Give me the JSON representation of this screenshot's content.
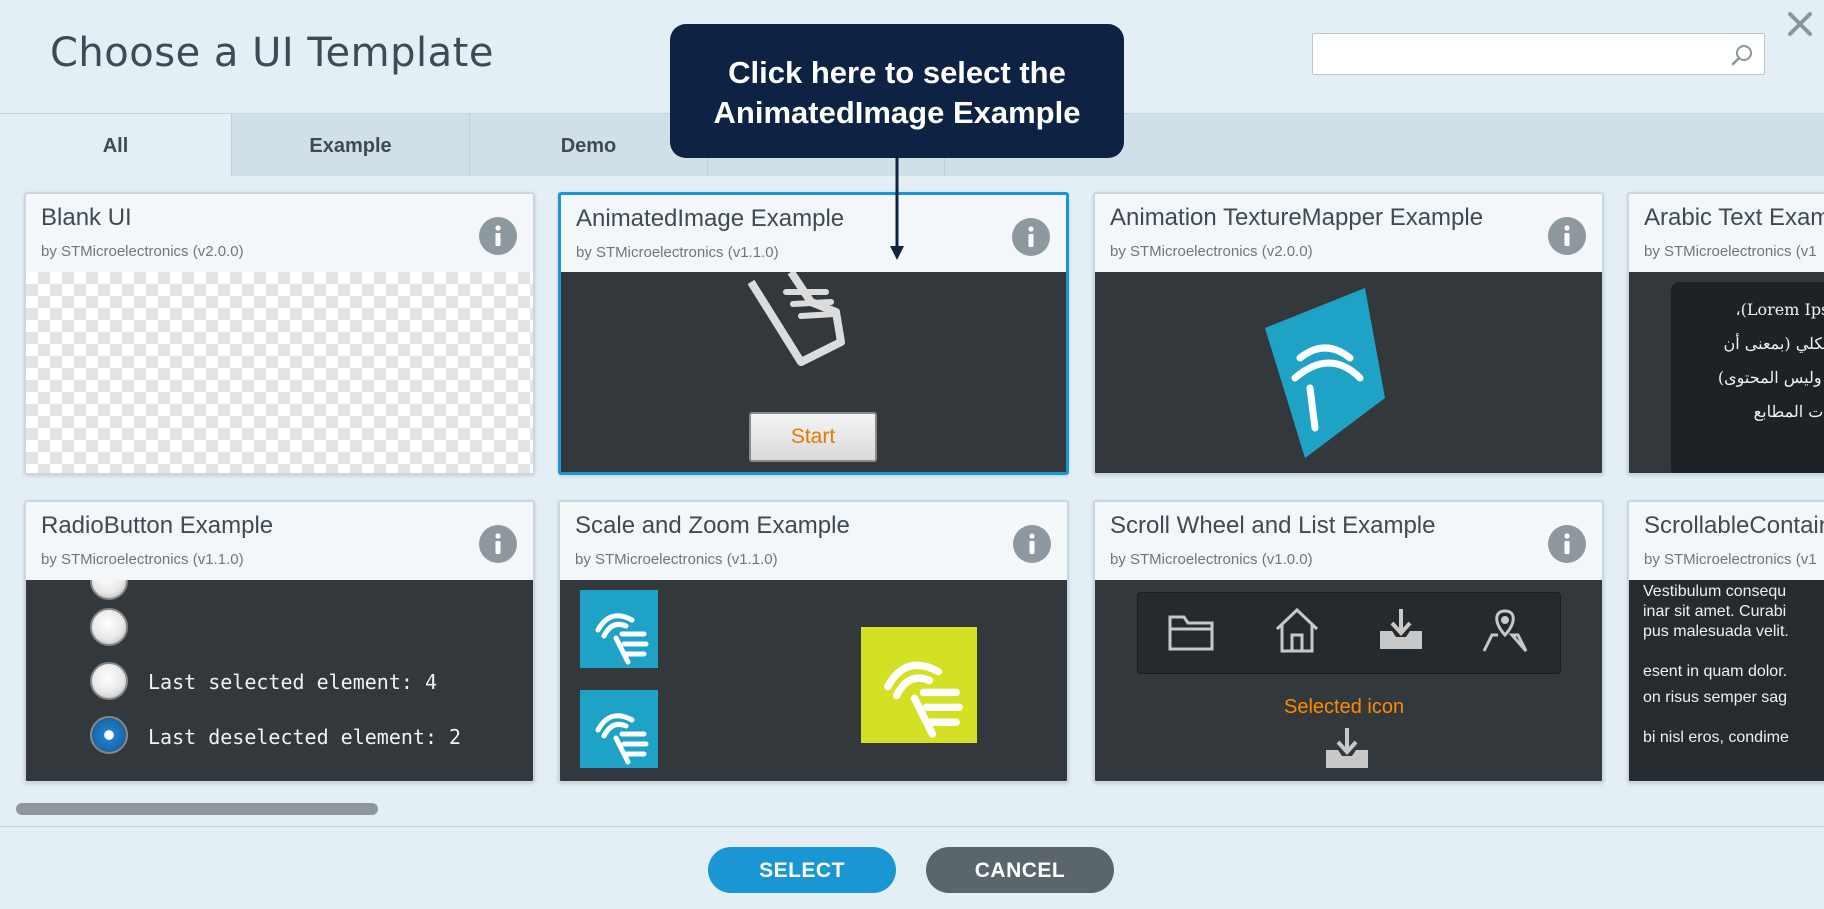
{
  "dialog": {
    "title": "Choose a UI Template",
    "search": {
      "value": "",
      "placeholder": ""
    }
  },
  "tabs": [
    {
      "label": "All",
      "active": true
    },
    {
      "label": "Example",
      "active": false
    },
    {
      "label": "Demo",
      "active": false
    },
    {
      "label": "",
      "active": false
    }
  ],
  "templates": [
    {
      "title": "Blank UI",
      "author": "by STMicroelectronics (v2.0.0)",
      "selected": false
    },
    {
      "title": "AnimatedImage Example",
      "author": "by STMicroelectronics (v1.1.0)",
      "selected": true,
      "button_label": "Start"
    },
    {
      "title": "Animation TextureMapper Example",
      "author": "by STMicroelectronics (v2.0.0)",
      "selected": false
    },
    {
      "title": "Arabic Text Example",
      "author": "by STMicroelectronics (v1",
      "selected": false,
      "preview_lines": [
        "(Lorem Ipsum)،",
        "ص شكلي (بمعنى أن",
        "شكل وليس المحتوى)",
        "صناعات المطابع"
      ]
    },
    {
      "title": "RadioButton Example",
      "author": "by STMicroelectronics (v1.1.0)",
      "selected": false,
      "radio_labels": [
        "Last selected element: 4",
        "Last deselected element: 2"
      ]
    },
    {
      "title": "Scale and Zoom Example",
      "author": "by STMicroelectronics (v1.1.0)",
      "selected": false
    },
    {
      "title": "Scroll Wheel and List Example",
      "author": "by STMicroelectronics (v1.0.0)",
      "selected": false,
      "selected_icon_label": "Selected icon"
    },
    {
      "title": "ScrollableContainer Example",
      "author": "by STMicroelectronics (v1",
      "selected": false,
      "preview_lines": [
        "Vestibulum consequ",
        "inar sit amet. Curabi",
        "pus malesuada velit.",
        "",
        "esent in quam dolor.",
        "on risus semper sag",
        "",
        "bi nisl eros, condime"
      ]
    }
  ],
  "buttons": {
    "select": "SELECT",
    "cancel": "CANCEL"
  },
  "callout": {
    "line1": "Click here to select the",
    "line2": "AnimatedImage Example"
  },
  "colors": {
    "accent": "#1a96d4",
    "callout_bg": "#0e2244",
    "cancel_bg": "#5b656c",
    "preview_bg": "#33383d"
  }
}
